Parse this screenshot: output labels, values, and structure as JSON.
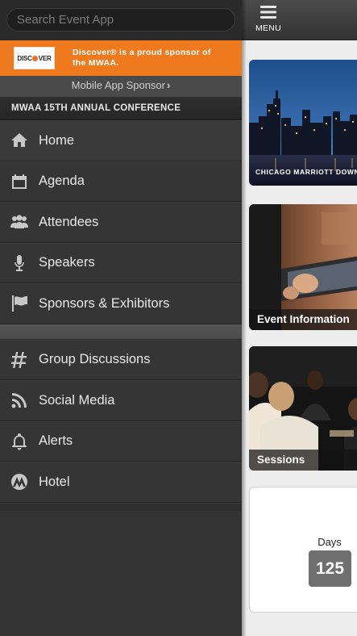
{
  "search": {
    "placeholder": "Search Event App"
  },
  "sponsor": {
    "logo_text": "DISC  VER",
    "text": "Discover® is a proud sponsor of the MWAA.",
    "link_label": "Mobile App Sponsor",
    "link_chevron": "›"
  },
  "conference": {
    "title": "MWAA 15TH ANNUAL CONFERENCE"
  },
  "nav_main": [
    {
      "label": "Home",
      "icon": "home-icon"
    },
    {
      "label": "Agenda",
      "icon": "calendar-icon"
    },
    {
      "label": "Attendees",
      "icon": "people-icon"
    },
    {
      "label": "Speakers",
      "icon": "microphone-icon"
    },
    {
      "label": "Sponsors & Exhibitors",
      "icon": "flag-icon"
    }
  ],
  "nav_secondary": [
    {
      "label": "Group Discussions",
      "icon": "hashtag-icon"
    },
    {
      "label": "Social Media",
      "icon": "rss-icon"
    },
    {
      "label": "Alerts",
      "icon": "bell-icon"
    },
    {
      "label": "Hotel",
      "icon": "marriott-icon"
    }
  ],
  "topbar": {
    "menu_label": "MENU"
  },
  "tiles": [
    {
      "caption": "CHICAGO MARRIOTT DOWNTOWN"
    },
    {
      "caption": "Event Information"
    },
    {
      "caption": "Sessions"
    }
  ],
  "countdown": {
    "label": "Days",
    "value": "125"
  },
  "colors": {
    "accent_orange": "#ef7a1e",
    "drawer_bg": "#333333",
    "content_bg": "#ededed"
  }
}
